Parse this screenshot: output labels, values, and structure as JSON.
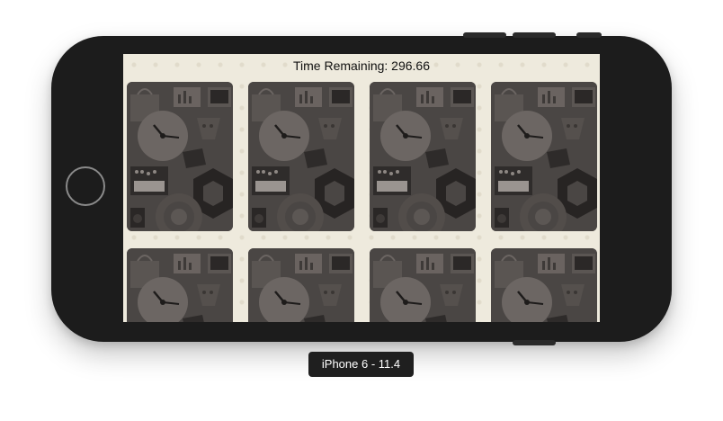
{
  "game": {
    "timer_text": "Time Remaining: 296.66",
    "cards": [
      {
        "name": "card-1"
      },
      {
        "name": "card-2"
      },
      {
        "name": "card-3"
      },
      {
        "name": "card-4"
      },
      {
        "name": "card-5"
      },
      {
        "name": "card-6"
      },
      {
        "name": "card-7"
      },
      {
        "name": "card-8"
      }
    ],
    "card_back_icons": [
      "clock-icon",
      "shopping-bag-icon",
      "chart-board-icon",
      "monitor-icon",
      "keyboard-icon",
      "hexagon-icon",
      "speaker-icon",
      "target-icon",
      "smiley-icon"
    ]
  },
  "simulator": {
    "device_label": "iPhone 6 - 11.4"
  },
  "colors": {
    "background": "#eeeadd",
    "card_back": "#4a4644",
    "phone_body": "#1c1c1c"
  }
}
